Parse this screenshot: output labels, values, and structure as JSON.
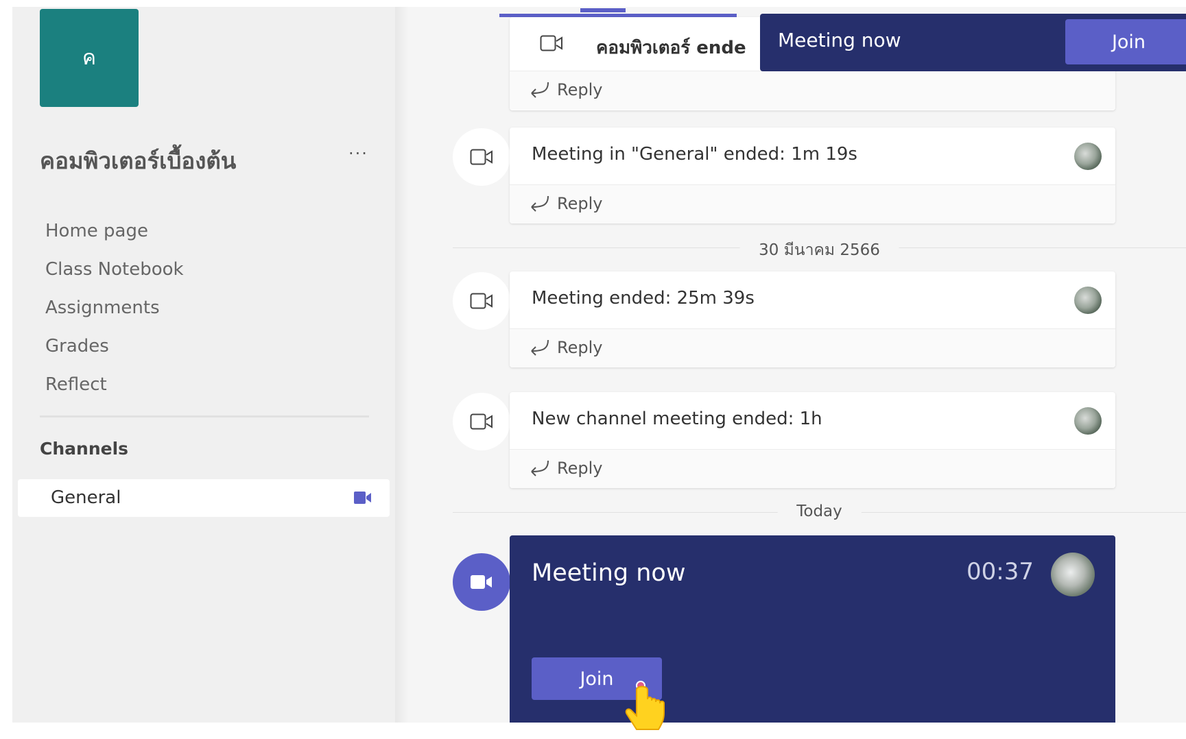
{
  "team": {
    "initial": "ค",
    "name": "คอมพิวเตอร์เบื้องต้น",
    "more_label": "···"
  },
  "nav": {
    "items": [
      "Home page",
      "Class Notebook",
      "Assignments",
      "Grades",
      "Reflect"
    ]
  },
  "channels": {
    "title": "Channels",
    "items": [
      {
        "label": "General"
      }
    ]
  },
  "feed": {
    "top_card": {
      "title": "คอมพิวเตอร์ ende",
      "reply": "Reply"
    },
    "cards": [
      {
        "title": "Meeting in \"General\" ended: 1m 19s",
        "reply": "Reply"
      },
      {
        "title": "Meeting ended: 25m 39s",
        "reply": "Reply"
      },
      {
        "title": "New channel meeting ended: 1h",
        "reply": "Reply"
      }
    ],
    "date_1": "30 มีนาคม 2566",
    "date_2": "Today",
    "meeting_now": {
      "title": "Meeting now",
      "timer": "00:37",
      "join": "Join"
    }
  },
  "banner": {
    "title": "Meeting now",
    "join": "Join"
  },
  "colors": {
    "accent": "#5b5fc7",
    "meeting_bg": "#262f6c",
    "team_tile": "#1b807f"
  }
}
